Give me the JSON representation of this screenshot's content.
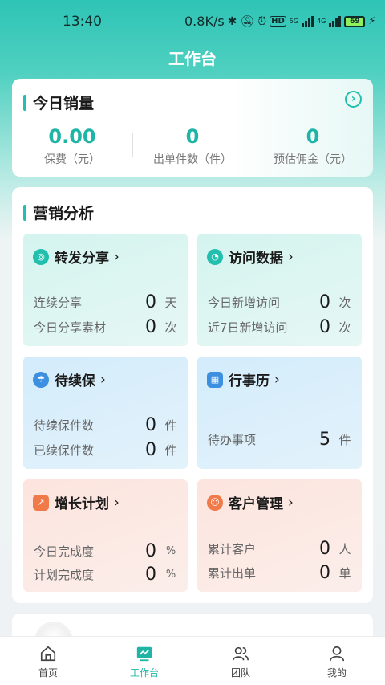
{
  "status": {
    "time": "13:40",
    "speed": "0.8K/s",
    "hd": "HD",
    "net1": "5G",
    "net2": "4G",
    "battery": "69"
  },
  "page_title": "工作台",
  "sales": {
    "title": "今日销量",
    "stats": [
      {
        "value": "0.00",
        "label": "保费（元）"
      },
      {
        "value": "0",
        "label": "出单件数（件）"
      },
      {
        "value": "0",
        "label": "预估佣金（元）"
      }
    ]
  },
  "marketing": {
    "title": "营销分析",
    "tiles": [
      {
        "title": "转发分享",
        "icon": "share-icon",
        "rows": [
          {
            "label": "连续分享",
            "value": "0",
            "unit": "天"
          },
          {
            "label": "今日分享素材",
            "value": "0",
            "unit": "次"
          }
        ]
      },
      {
        "title": "访问数据",
        "icon": "pie-chart-icon",
        "rows": [
          {
            "label": "今日新增访问",
            "value": "0",
            "unit": "次"
          },
          {
            "label": "近7日新增访问",
            "value": "0",
            "unit": "次"
          }
        ]
      },
      {
        "title": "待续保",
        "icon": "umbrella-icon",
        "rows": [
          {
            "label": "待续保件数",
            "value": "0",
            "unit": "件"
          },
          {
            "label": "已续保件数",
            "value": "0",
            "unit": "件"
          }
        ]
      },
      {
        "title": "行事历",
        "icon": "calendar-icon",
        "rows": [
          {
            "label": "待办事项",
            "value": "5",
            "unit": "件"
          }
        ]
      },
      {
        "title": "增长计划",
        "icon": "trend-icon",
        "rows": [
          {
            "label": "今日完成度",
            "value": "0",
            "unit": "%"
          },
          {
            "label": "计划完成度",
            "value": "0",
            "unit": "%"
          }
        ]
      },
      {
        "title": "客户管理",
        "icon": "customer-icon",
        "rows": [
          {
            "label": "累计客户",
            "value": "0",
            "unit": "人"
          },
          {
            "label": "累计出单",
            "value": "0",
            "unit": "单"
          }
        ]
      }
    ]
  },
  "tabbar": {
    "items": [
      {
        "label": "首页",
        "icon": "home-icon"
      },
      {
        "label": "工作台",
        "icon": "workbench-icon"
      },
      {
        "label": "团队",
        "icon": "team-icon"
      },
      {
        "label": "我的",
        "icon": "profile-icon"
      }
    ]
  },
  "colors": {
    "accent": "#1fb5a6",
    "tile_teal": "#d4f4ef",
    "tile_blue": "#d3ecfb",
    "tile_pink": "#fde4de"
  }
}
